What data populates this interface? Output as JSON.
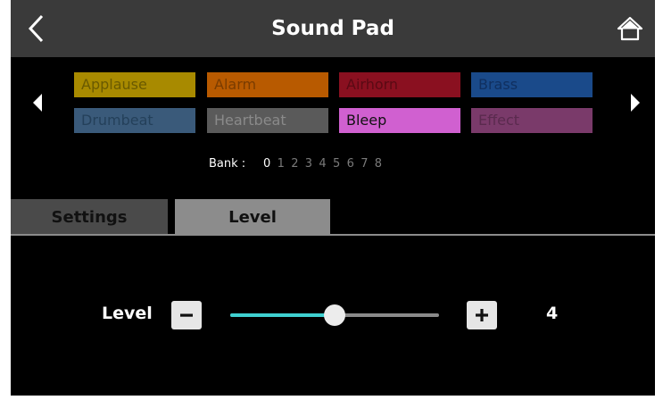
{
  "header": {
    "title": "Sound Pad",
    "back_icon": "chevron-left-icon",
    "home_icon": "home-icon"
  },
  "pads": [
    {
      "label": "Applause",
      "bg": "#a88a00",
      "fg": "#6a5a00"
    },
    {
      "label": "Alarm",
      "bg": "#b85a00",
      "fg": "#7a3c00"
    },
    {
      "label": "Airhorn",
      "bg": "#8a1020",
      "fg": "#5a0a14"
    },
    {
      "label": "Brass",
      "bg": "#1a4a8a",
      "fg": "#103060"
    },
    {
      "label": "Drumbeat",
      "bg": "#3a5a7a",
      "fg": "#24405a"
    },
    {
      "label": "Heartbeat",
      "bg": "#5a5a5a",
      "fg": "#8a8a8a"
    },
    {
      "label": "Bleep",
      "bg": "#d060d0",
      "fg": "#111111"
    },
    {
      "label": "Effect",
      "bg": "#7a3a6a",
      "fg": "#5a2a4e"
    }
  ],
  "bank": {
    "label": "Bank :",
    "numbers": [
      "0",
      "1",
      "2",
      "3",
      "4",
      "5",
      "6",
      "7",
      "8"
    ],
    "active": "0"
  },
  "tabs": {
    "settings": "Settings",
    "level": "Level"
  },
  "level": {
    "label": "Level",
    "value": "4",
    "fraction": 0.5,
    "accent": "#3fd0d0"
  }
}
